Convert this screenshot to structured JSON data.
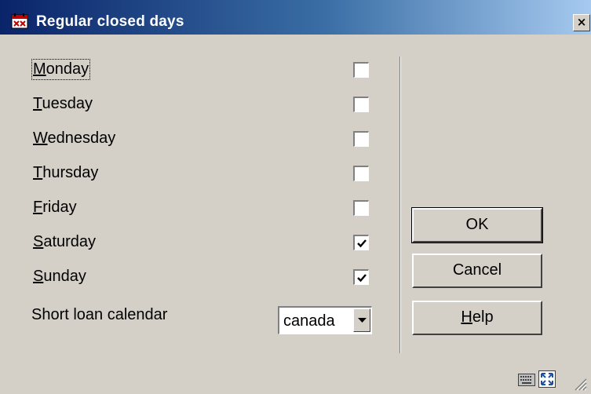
{
  "window": {
    "title": "Regular closed days",
    "close_glyph": "×"
  },
  "days": [
    {
      "accel": "M",
      "rest": "onday",
      "checked": false,
      "focused": true
    },
    {
      "accel": "T",
      "rest": "uesday",
      "checked": false,
      "focused": false
    },
    {
      "accel": "W",
      "rest": "ednesday",
      "checked": false,
      "focused": false
    },
    {
      "accel": "T",
      "rest": "hursday",
      "checked": false,
      "focused": false
    },
    {
      "accel": "F",
      "rest": "riday",
      "checked": false,
      "focused": false
    },
    {
      "accel": "S",
      "rest": "aturday",
      "checked": true,
      "focused": false
    },
    {
      "accel": "S",
      "rest": "unday",
      "checked": true,
      "focused": false
    }
  ],
  "short_loan": {
    "label": "Short loan calendar",
    "value": "canada"
  },
  "buttons": {
    "ok": "OK",
    "cancel": "Cancel",
    "help_accel": "H",
    "help_rest": "elp"
  },
  "icons": {
    "app": "calendar-app-icon",
    "keyboard": "keyboard-icon",
    "resize": "resize-icon",
    "grip": "size-grip-icon"
  }
}
